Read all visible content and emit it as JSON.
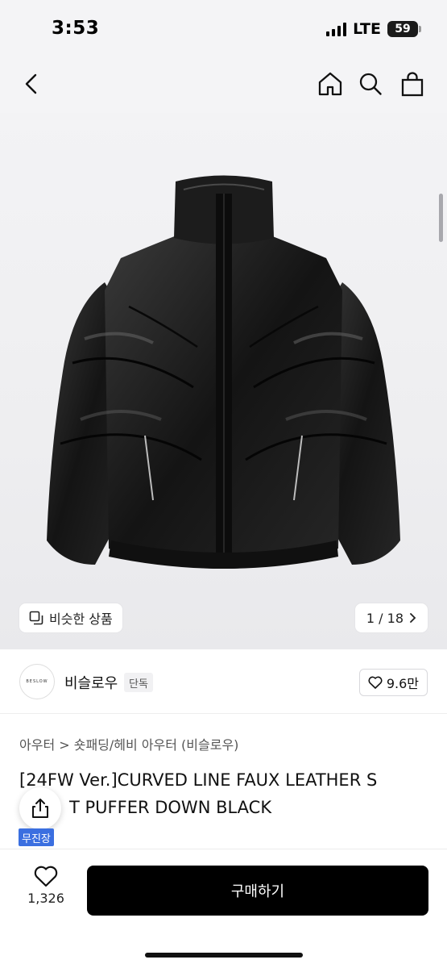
{
  "status_bar": {
    "time": "3:53",
    "network": "LTE",
    "battery": "59"
  },
  "nav": {
    "icons": [
      "chevron-left-icon",
      "home-icon",
      "search-icon",
      "shopping-bag-icon"
    ]
  },
  "gallery": {
    "similar_label": "비슷한 상품",
    "page_indicator": "1 / 18"
  },
  "brand": {
    "logo_text": "BESLOW",
    "name": "비슬로우",
    "badge": "단독",
    "like_count": "9.6만"
  },
  "product": {
    "category": "아우터 > 숏패딩/헤비 아우터 (비슬로우)",
    "title_line1": "[24FW Ver.]CURVED LINE FAUX LEATHER S",
    "title_line2": "T PUFFER DOWN BLACK",
    "free_shipping_badge": "무진장"
  },
  "bottom_bar": {
    "wish_count": "1,326",
    "buy_label": "구매하기"
  },
  "colors": {
    "accent_blue": "#3b6fe0",
    "buy_button": "#000000"
  }
}
